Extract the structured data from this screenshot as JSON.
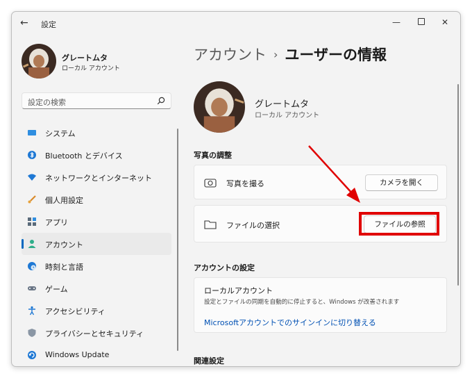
{
  "window": {
    "title": "設定"
  },
  "user": {
    "name": "グレートムタ",
    "account_type": "ローカル アカウント"
  },
  "search": {
    "placeholder": "設定の検索"
  },
  "sidebar": {
    "items": [
      {
        "label": "システム",
        "icon": "system-icon"
      },
      {
        "label": "Bluetooth とデバイス",
        "icon": "bluetooth-icon"
      },
      {
        "label": "ネットワークとインターネット",
        "icon": "network-icon"
      },
      {
        "label": "個人用設定",
        "icon": "brush-icon"
      },
      {
        "label": "アプリ",
        "icon": "apps-icon"
      },
      {
        "label": "アカウント",
        "icon": "account-icon",
        "active": true
      },
      {
        "label": "時刻と言語",
        "icon": "time-language-icon"
      },
      {
        "label": "ゲーム",
        "icon": "gamepad-icon"
      },
      {
        "label": "アクセシビリティ",
        "icon": "accessibility-icon"
      },
      {
        "label": "プライバシーとセキュリティ",
        "icon": "shield-icon"
      },
      {
        "label": "Windows Update",
        "icon": "windows-update-icon"
      }
    ]
  },
  "main": {
    "breadcrumb_parent": "アカウント",
    "breadcrumb_separator": "›",
    "breadcrumb_current": "ユーザーの情報",
    "photo_section_title": "写真の調整",
    "take_photo_label": "写真を撮る",
    "open_camera_button": "カメラを開く",
    "choose_file_label": "ファイルの選択",
    "browse_files_button": "ファイルの参照",
    "account_settings_title": "アカウントの設定",
    "local_account_title": "ローカルアカウント",
    "local_account_desc": "設定とファイルの同期を自動的に停止すると、Windows が改善されます",
    "switch_link": "Microsoftアカウントでのサインインに切り替える",
    "related_settings_title": "関連設定"
  },
  "colors": {
    "accent": "#0067c0",
    "highlight": "#e00000",
    "link": "#0050b3"
  }
}
